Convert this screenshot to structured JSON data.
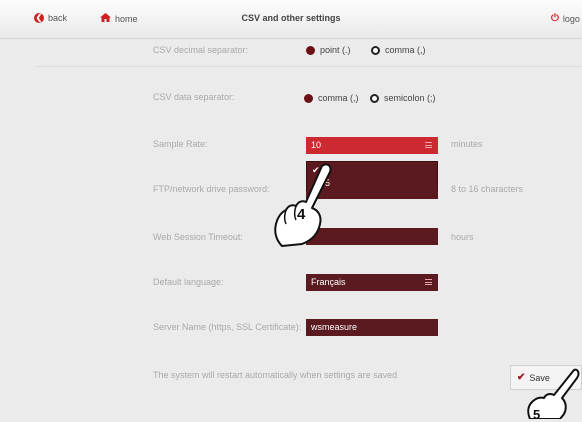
{
  "header": {
    "back_label": "back",
    "home_label": "home",
    "title": "CSV and other settings",
    "logout_label": "logo"
  },
  "settings": {
    "decimal": {
      "label": "CSV decimal separator:",
      "options": [
        "point (.)",
        "comma (,)"
      ],
      "selected": "point (.)"
    },
    "data_sep": {
      "label": "CSV data separator:",
      "options": [
        "comma (,)",
        "semicolon (;)"
      ],
      "selected": "comma (,)"
    },
    "sample_rate": {
      "label": "Sample Rate:",
      "value": "10",
      "unit": "minutes",
      "dropdown_options": [
        "✔",
        "5"
      ]
    },
    "ftp_password": {
      "label": "FTP/network drive password:",
      "value": "",
      "hint": "8 to 16 characters"
    },
    "web_timeout": {
      "label": "Web Session Timeout:",
      "value": "",
      "unit": "hours"
    },
    "language": {
      "label": "Default language:",
      "value": "Français"
    },
    "server_name": {
      "label": "Server Name (https, SSL Certificate):",
      "value": "wsmeasure"
    },
    "restart_note": "The system will restart automatically when settings are saved"
  },
  "save_label": "Save",
  "annotations": {
    "step4": "4",
    "step5": "5"
  },
  "colors": {
    "accent_dark": "#5a1a1f",
    "accent_red": "#cc2a30",
    "icon_red": "#cc2222"
  },
  "icons": [
    "back-circle-icon",
    "home-icon",
    "power-icon",
    "menu-lines-icon",
    "checkmark-icon",
    "hand-pointer-icon"
  ]
}
